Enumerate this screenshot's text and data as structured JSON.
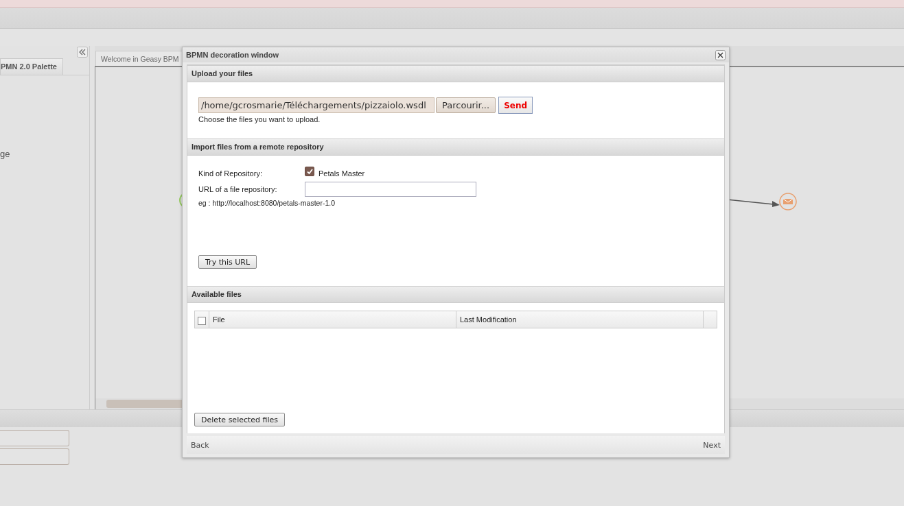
{
  "app": {
    "palette_tab": "PMN 2.0 Palette",
    "palette_item": "ge",
    "editor_tab": "Welcome in Geasy BPM"
  },
  "dialog": {
    "title": "BPMN decoration window",
    "upload": {
      "header": "Upload your files",
      "file_path": "/home/gcrosmarie/Téléchargements/pizzaiolo.wsdl",
      "browse_button": "Parcourir...",
      "send_button": "Send",
      "hint": "Choose the files you want to upload."
    },
    "import": {
      "header": "Import files from a remote repository",
      "kind_label": "Kind of Repository:",
      "petals_option": {
        "label": "Petals Master",
        "checked": true
      },
      "url_label": "URL of a file repository:",
      "example": "eg : http://localhost:8080/petals-master-1.0",
      "try_button": "Try this URL"
    },
    "files": {
      "header": "Available files",
      "select_all": {
        "checked": false
      },
      "columns": [
        "File",
        "Last Modification"
      ],
      "delete_button": "Delete selected files"
    },
    "footer": {
      "back": "Back",
      "next": "Next"
    }
  }
}
